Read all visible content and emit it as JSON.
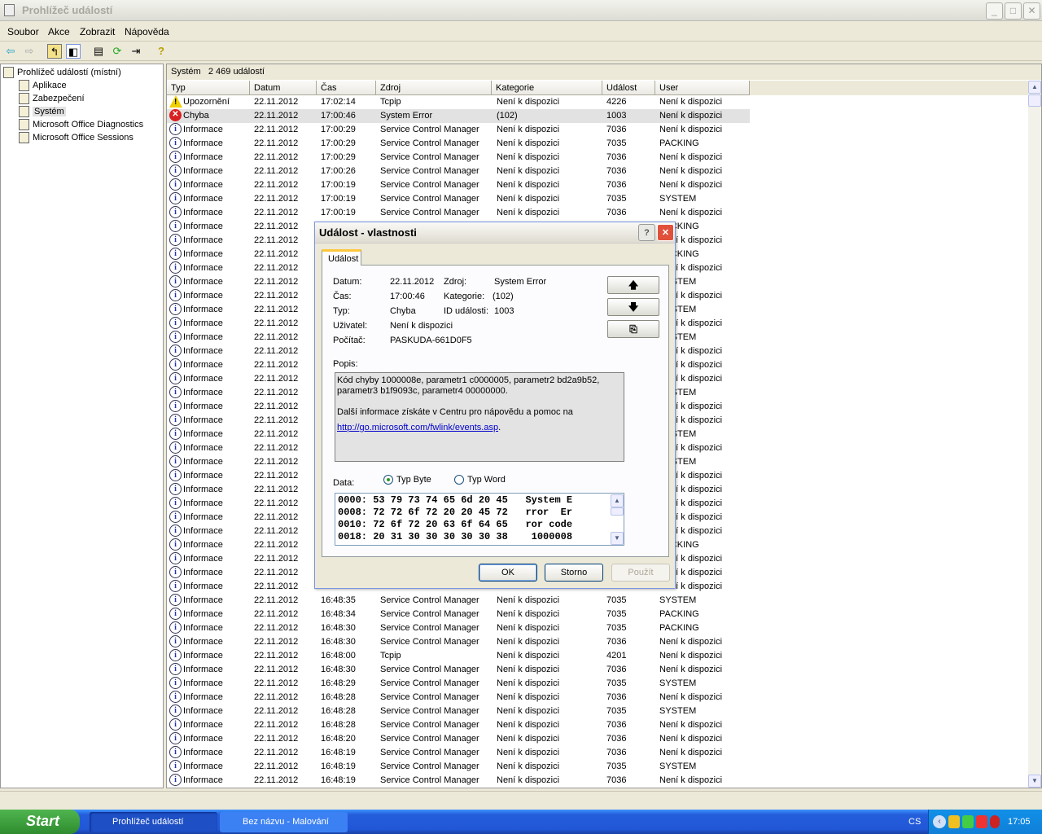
{
  "window": {
    "title": "Prohlížeč událostí",
    "minimize": "_",
    "maximize": "□",
    "close": "✕"
  },
  "menu": [
    "Soubor",
    "Akce",
    "Zobrazit",
    "Nápověda"
  ],
  "toolbar": [
    "back-icon",
    "forward-icon",
    "up-folder-icon",
    "show-hide-tree-icon",
    "properties-icon",
    "refresh-icon",
    "export-list-icon",
    "help-icon"
  ],
  "tree": {
    "root": "Prohlížeč událostí (místní)",
    "items": [
      "Aplikace",
      "Zabezpečení",
      "Systém",
      "Microsoft Office Diagnostics",
      "Microsoft Office Sessions"
    ],
    "selected": "Systém"
  },
  "list": {
    "title": "Systém",
    "count": "2 469 událostí",
    "columns": [
      "Typ",
      "Datum",
      "Čas",
      "Zdroj",
      "Kategorie",
      "Událost",
      "User"
    ],
    "rows": [
      [
        "Upozornění",
        "22.11.2012",
        "17:02:14",
        "Tcpip",
        "Není k dispozici",
        "4226",
        "Není k dispozici"
      ],
      [
        "Chyba",
        "22.11.2012",
        "17:00:46",
        "System Error",
        "(102)",
        "1003",
        "Není k dispozici"
      ],
      [
        "Informace",
        "22.11.2012",
        "17:00:29",
        "Service Control Manager",
        "Není k dispozici",
        "7036",
        "Není k dispozici"
      ],
      [
        "Informace",
        "22.11.2012",
        "17:00:29",
        "Service Control Manager",
        "Není k dispozici",
        "7035",
        "PACKING"
      ],
      [
        "Informace",
        "22.11.2012",
        "17:00:29",
        "Service Control Manager",
        "Není k dispozici",
        "7036",
        "Není k dispozici"
      ],
      [
        "Informace",
        "22.11.2012",
        "17:00:26",
        "Service Control Manager",
        "Není k dispozici",
        "7036",
        "Není k dispozici"
      ],
      [
        "Informace",
        "22.11.2012",
        "17:00:19",
        "Service Control Manager",
        "Není k dispozici",
        "7036",
        "Není k dispozici"
      ],
      [
        "Informace",
        "22.11.2012",
        "17:00:19",
        "Service Control Manager",
        "Není k dispozici",
        "7035",
        "SYSTEM"
      ],
      [
        "Informace",
        "22.11.2012",
        "17:00:19",
        "Service Control Manager",
        "Není k dispozici",
        "7036",
        "Není k dispozici"
      ],
      [
        "Informace",
        "22.11.2012",
        "",
        "",
        "",
        "",
        "PACKING"
      ],
      [
        "Informace",
        "22.11.2012",
        "",
        "",
        "",
        "",
        "Není k dispozici"
      ],
      [
        "Informace",
        "22.11.2012",
        "",
        "",
        "",
        "",
        "PACKING"
      ],
      [
        "Informace",
        "22.11.2012",
        "",
        "",
        "",
        "",
        "Není k dispozici"
      ],
      [
        "Informace",
        "22.11.2012",
        "",
        "",
        "",
        "",
        "SYSTEM"
      ],
      [
        "Informace",
        "22.11.2012",
        "",
        "",
        "",
        "",
        "Není k dispozici"
      ],
      [
        "Informace",
        "22.11.2012",
        "",
        "",
        "",
        "",
        "SYSTEM"
      ],
      [
        "Informace",
        "22.11.2012",
        "",
        "",
        "",
        "",
        "Není k dispozici"
      ],
      [
        "Informace",
        "22.11.2012",
        "",
        "",
        "",
        "",
        "SYSTEM"
      ],
      [
        "Informace",
        "22.11.2012",
        "",
        "",
        "",
        "",
        "Není k dispozici"
      ],
      [
        "Informace",
        "22.11.2012",
        "",
        "",
        "",
        "",
        "Není k dispozici"
      ],
      [
        "Informace",
        "22.11.2012",
        "",
        "",
        "",
        "",
        "Není k dispozici"
      ],
      [
        "Informace",
        "22.11.2012",
        "",
        "",
        "",
        "",
        "SYSTEM"
      ],
      [
        "Informace",
        "22.11.2012",
        "",
        "",
        "",
        "",
        "Není k dispozici"
      ],
      [
        "Informace",
        "22.11.2012",
        "",
        "",
        "",
        "",
        "Není k dispozici"
      ],
      [
        "Informace",
        "22.11.2012",
        "",
        "",
        "",
        "",
        "SYSTEM"
      ],
      [
        "Informace",
        "22.11.2012",
        "",
        "",
        "",
        "",
        "Není k dispozici"
      ],
      [
        "Informace",
        "22.11.2012",
        "",
        "",
        "",
        "",
        "SYSTEM"
      ],
      [
        "Informace",
        "22.11.2012",
        "",
        "",
        "",
        "",
        "Není k dispozici"
      ],
      [
        "Informace",
        "22.11.2012",
        "",
        "",
        "",
        "",
        "Není k dispozici"
      ],
      [
        "Informace",
        "22.11.2012",
        "",
        "",
        "",
        "",
        "Není k dispozici"
      ],
      [
        "Informace",
        "22.11.2012",
        "",
        "",
        "",
        "",
        "Není k dispozici"
      ],
      [
        "Informace",
        "22.11.2012",
        "",
        "",
        "",
        "",
        "Není k dispozici"
      ],
      [
        "Informace",
        "22.11.2012",
        "",
        "",
        "",
        "",
        "PACKING"
      ],
      [
        "Informace",
        "22.11.2012",
        "",
        "",
        "",
        "",
        "Není k dispozici"
      ],
      [
        "Informace",
        "22.11.2012",
        "",
        "",
        "",
        "",
        "Není k dispozici"
      ],
      [
        "Informace",
        "22.11.2012",
        "",
        "",
        "",
        "",
        "Není k dispozici"
      ],
      [
        "Informace",
        "22.11.2012",
        "16:48:35",
        "Service Control Manager",
        "Není k dispozici",
        "7035",
        "SYSTEM"
      ],
      [
        "Informace",
        "22.11.2012",
        "16:48:34",
        "Service Control Manager",
        "Není k dispozici",
        "7035",
        "PACKING"
      ],
      [
        "Informace",
        "22.11.2012",
        "16:48:30",
        "Service Control Manager",
        "Není k dispozici",
        "7035",
        "PACKING"
      ],
      [
        "Informace",
        "22.11.2012",
        "16:48:30",
        "Service Control Manager",
        "Není k dispozici",
        "7036",
        "Není k dispozici"
      ],
      [
        "Informace",
        "22.11.2012",
        "16:48:00",
        "Tcpip",
        "Není k dispozici",
        "4201",
        "Není k dispozici"
      ],
      [
        "Informace",
        "22.11.2012",
        "16:48:30",
        "Service Control Manager",
        "Není k dispozici",
        "7036",
        "Není k dispozici"
      ],
      [
        "Informace",
        "22.11.2012",
        "16:48:29",
        "Service Control Manager",
        "Není k dispozici",
        "7035",
        "SYSTEM"
      ],
      [
        "Informace",
        "22.11.2012",
        "16:48:28",
        "Service Control Manager",
        "Není k dispozici",
        "7036",
        "Není k dispozici"
      ],
      [
        "Informace",
        "22.11.2012",
        "16:48:28",
        "Service Control Manager",
        "Není k dispozici",
        "7035",
        "SYSTEM"
      ],
      [
        "Informace",
        "22.11.2012",
        "16:48:28",
        "Service Control Manager",
        "Není k dispozici",
        "7036",
        "Není k dispozici"
      ],
      [
        "Informace",
        "22.11.2012",
        "16:48:20",
        "Service Control Manager",
        "Není k dispozici",
        "7036",
        "Není k dispozici"
      ],
      [
        "Informace",
        "22.11.2012",
        "16:48:19",
        "Service Control Manager",
        "Není k dispozici",
        "7036",
        "Není k dispozici"
      ],
      [
        "Informace",
        "22.11.2012",
        "16:48:19",
        "Service Control Manager",
        "Není k dispozici",
        "7035",
        "SYSTEM"
      ],
      [
        "Informace",
        "22.11.2012",
        "16:48:19",
        "Service Control Manager",
        "Není k dispozici",
        "7036",
        "Není k dispozici"
      ]
    ]
  },
  "dialog": {
    "title": "Událost - vlastnosti",
    "help": "?",
    "close": "✕",
    "tab": "Událost",
    "labels": {
      "date": "Datum:",
      "time": "Čas:",
      "type": "Typ:",
      "user": "Uživatel:",
      "computer": "Počítač:",
      "source": "Zdroj:",
      "category": "Kategorie:",
      "event_id": "ID události:",
      "description": "Popis:",
      "data": "Data:"
    },
    "values": {
      "date": "22.11.2012",
      "time": "17:00:46",
      "type": "Chyba",
      "user": "Není k dispozici",
      "computer": "PASKUDA-661D0F5",
      "source": "System Error",
      "category": "(102)",
      "event_id": "1003"
    },
    "description": {
      "line1": "Kód chyby 1000008e, parametr1 c0000005, parametr2 bd2a9b52, parametr3 b1f9093c, parametr4 00000000.",
      "line2": "Další informace získáte v Centru pro nápovědu a pomoc na",
      "link": "http://go.microsoft.com/fwlink/events.asp",
      "after_link": "."
    },
    "radio_byte": "Typ Byte",
    "radio_word": "Typ Word",
    "selected_radio": "Typ Byte",
    "hex": [
      "0000: 53 79 73 74 65 6d 20 45   System E",
      "0008: 72 72 6f 72 20 20 45 72   rror  Er",
      "0010: 72 6f 72 20 63 6f 64 65   ror code",
      "0018: 20 31 30 30 30 30 30 38    1000008"
    ],
    "nav": {
      "up": "🡅",
      "down": "🡇",
      "copy": "⎘"
    },
    "ok": "OK",
    "cancel": "Storno",
    "apply": "Použít"
  },
  "taskbar": {
    "start": "Start",
    "tasks": [
      "Prohlížeč událostí",
      "Bez názvu - Malování"
    ],
    "lang": "CS",
    "clock": "17:05"
  }
}
